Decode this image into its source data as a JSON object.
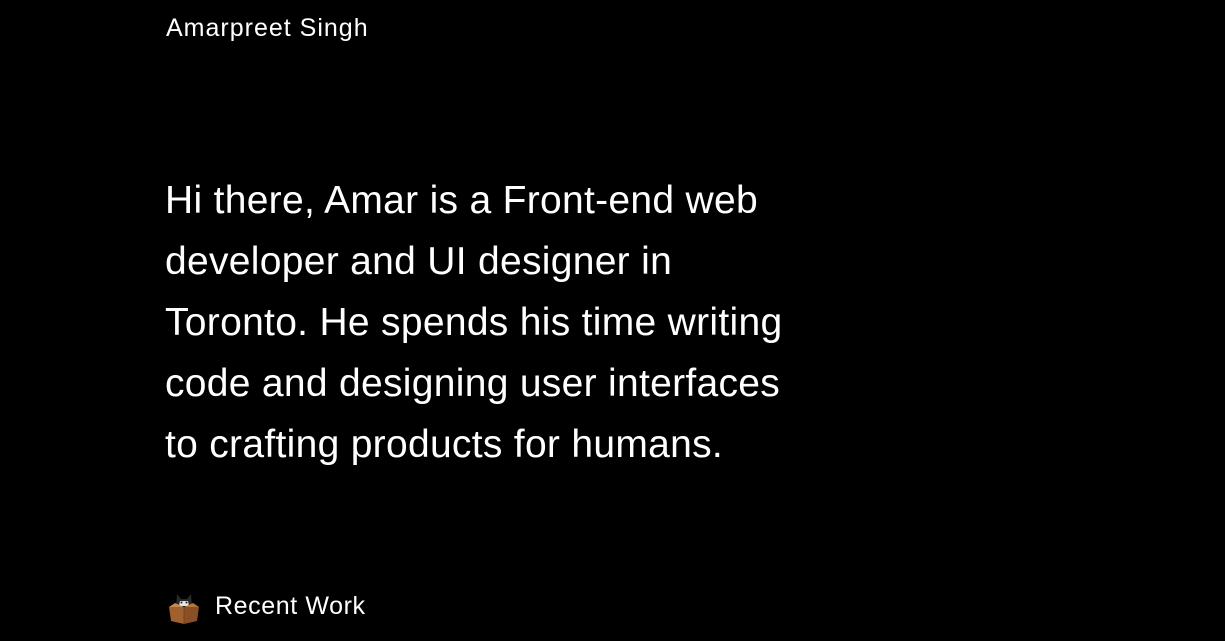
{
  "header": {
    "site_name": "Amarpreet Singh"
  },
  "intro": {
    "lines": [
      "Hi there, Amar is a Front-end web",
      "developer and UI designer in",
      "Toronto. He spends his time writing",
      "code and designing user interfaces",
      "to crafting products for humans."
    ]
  },
  "recent_work": {
    "label": "Recent Work",
    "icon": "cat-in-box-icon"
  },
  "colors": {
    "background": "#000000",
    "text": "#ffffff",
    "box": "#a0612f"
  }
}
